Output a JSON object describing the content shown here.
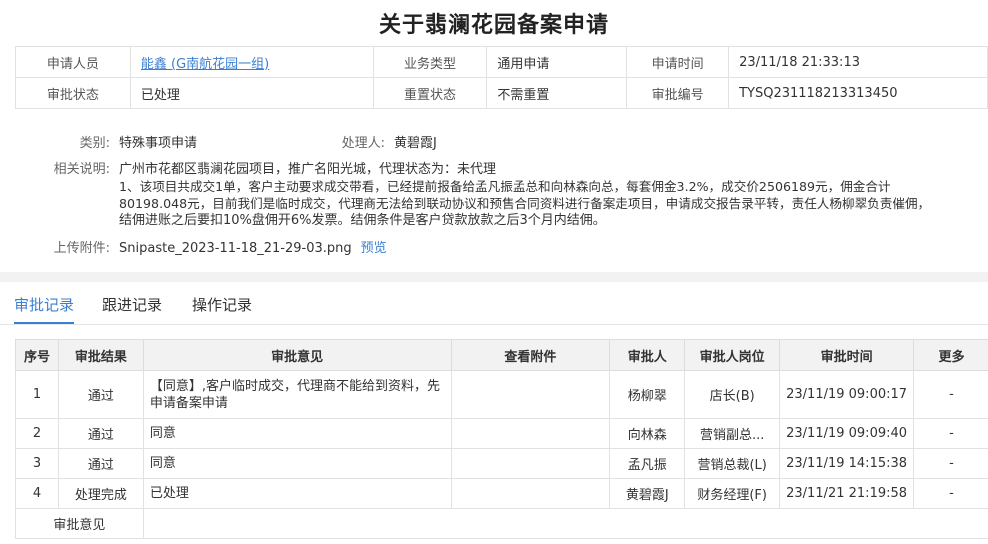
{
  "page_title": "关于翡澜花园备案申请",
  "info": {
    "applicant_label": "申请人员",
    "applicant_value": "能鑫 (G南航花园一组)",
    "business_label": "业务类型",
    "business_value": "通用申请",
    "apply_time_label": "申请时间",
    "apply_time_value": "23/11/18 21:33:13",
    "approval_status_label": "审批状态",
    "approval_status_value": "已处理",
    "reset_status_label": "重置状态",
    "reset_status_value": "不需重置",
    "approval_no_label": "审批编号",
    "approval_no_value": "TYSQ231118213313450"
  },
  "detail": {
    "category_label": "类别:",
    "category_value": "特殊事项申请",
    "handler_label": "处理人:",
    "handler_value": "黄碧霞J",
    "desc_label": "相关说明:",
    "desc_line1": "广州市花都区翡澜花园项目，推广名阳光城，代理状态为：未代理",
    "desc_line2": "1、该项目共成交1单，客户主动要求成交带看，已经提前报备给孟凡振孟总和向林森向总，每套佣金3.2%，成交价2506189元，佣金合计",
    "desc_line3": "80198.048元，目前我们是临时成交，代理商无法给到联动协议和预售合同资料进行备案走项目，申请成交报告录平转，责任人杨柳翠负责催佣，",
    "desc_line4": "结佣进账之后要扣10%盘佣开6%发票。结佣条件是客户贷款放款之后3个月内结佣。",
    "attach_label": "上传附件:",
    "attach_value": "Snipaste_2023-11-18_21-29-03.png",
    "preview_label": "预览"
  },
  "tabs": [
    {
      "label": "审批记录"
    },
    {
      "label": "跟进记录"
    },
    {
      "label": "操作记录"
    }
  ],
  "table": {
    "headers": [
      "序号",
      "审批结果",
      "审批意见",
      "查看附件",
      "审批人",
      "审批人岗位",
      "审批时间",
      "更多"
    ],
    "rows": [
      {
        "no": "1",
        "result": "通过",
        "opinion": "【同意】,客户临时成交，代理商不能给到资料，先申请备案申请",
        "attach": "",
        "approver": "杨柳翠",
        "post": "店长(B)",
        "time": "23/11/19 09:00:17",
        "more": "-"
      },
      {
        "no": "2",
        "result": "通过",
        "opinion": "同意",
        "attach": "",
        "approver": "向林森",
        "post": "营销副总...",
        "time": "23/11/19 09:09:40",
        "more": "-"
      },
      {
        "no": "3",
        "result": "通过",
        "opinion": "同意",
        "attach": "",
        "approver": "孟凡振",
        "post": "营销总裁(L)",
        "time": "23/11/19 14:15:38",
        "more": "-"
      },
      {
        "no": "4",
        "result": "处理完成",
        "opinion": "已处理",
        "attach": "",
        "approver": "黄碧霞J",
        "post": "财务经理(F)",
        "time": "23/11/21 21:19:58",
        "more": "-"
      }
    ],
    "footer_label": "审批意见"
  },
  "colors": {
    "accent": "#3b7fd1",
    "status_red": "#e02020"
  }
}
